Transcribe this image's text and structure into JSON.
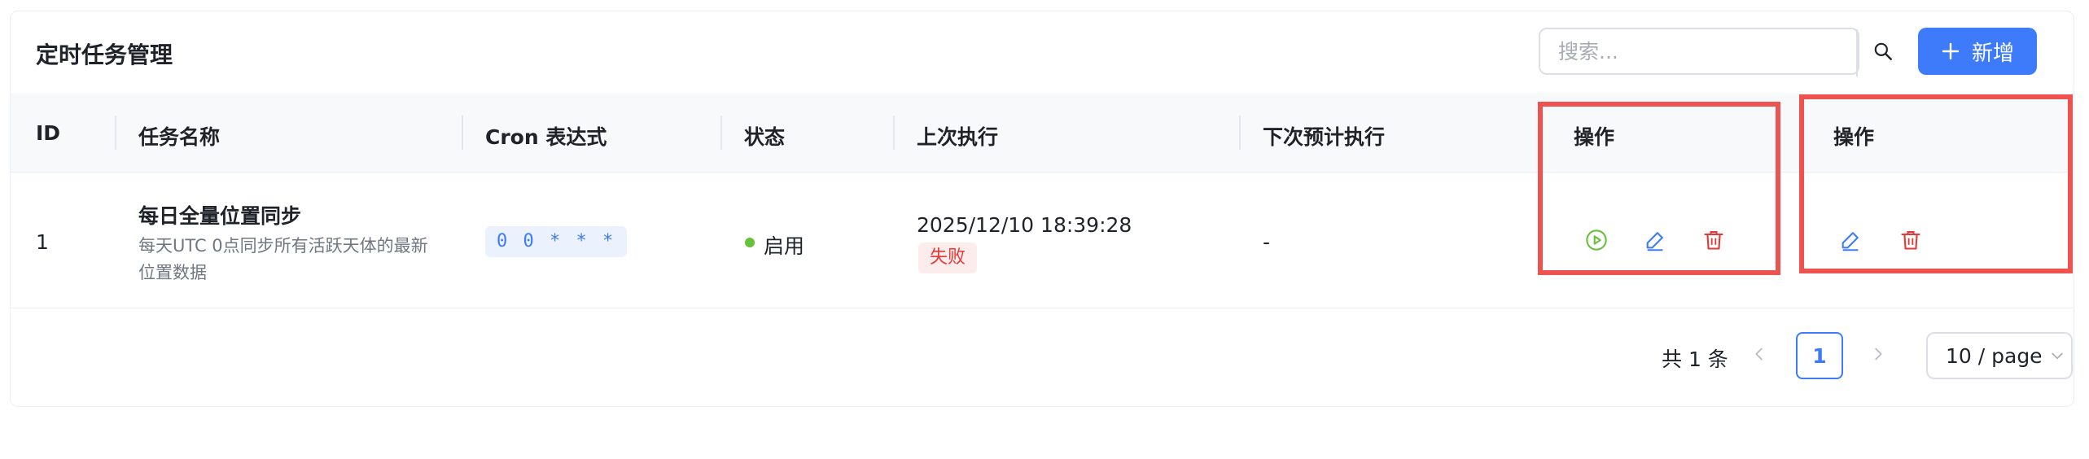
{
  "page": {
    "title": "定时任务管理"
  },
  "toolbar": {
    "search_placeholder": "搜索...",
    "add_label": "新增",
    "search_icon": "search-icon",
    "add_icon": "plus-icon"
  },
  "table": {
    "columns": [
      "ID",
      "任务名称",
      "Cron 表达式",
      "状态",
      "上次执行",
      "下次预计执行",
      "操作",
      "操作"
    ],
    "rows": [
      {
        "id": "1",
        "name": "每日全量位置同步",
        "description": "每天UTC 0点同步所有活跃天体的最新位置数据",
        "cron": "0 0 * * *",
        "status": "启用",
        "last_run": "2025/12/10 18:39:28",
        "last_result": "失败",
        "next_run": "-"
      }
    ]
  },
  "pagination": {
    "total_text": "共 1 条",
    "current_page": "1",
    "page_size": "10 / page"
  },
  "colors": {
    "primary": "#3e7bfa",
    "success": "#67c23a",
    "danger": "#e53935",
    "highlight": "#ef5350"
  }
}
